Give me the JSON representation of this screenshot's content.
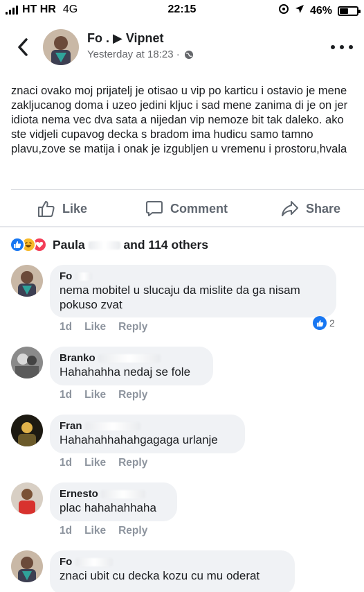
{
  "status_bar": {
    "carrier": "HT HR",
    "network": "4G",
    "time": "22:15",
    "battery": "46%"
  },
  "post": {
    "author": "Fo . ▶ Vipnet",
    "timestamp": "Yesterday at 18:23 ·",
    "text": "znaci ovako moj prijatelj je otisao u vip po karticu i ostavio je mene zakljucanog doma i uzeo jedini kljuc i sad mene zanima di je on jer idiota nema vec dva sata a nijedan vip nemoze bit tak daleko. ako ste vidjeli cupavog decka s bradom ima hudicu samo tamno plavu,zove se matija i onak je izgubljen u vremenu i prostoru,hvala"
  },
  "actions": {
    "like": "Like",
    "comment": "Comment",
    "share": "Share"
  },
  "reactions": {
    "summary_name": "Paula",
    "summary_rest": "and 114 others",
    "icons": [
      "like-icon",
      "haha-icon",
      "love-icon"
    ]
  },
  "comments": [
    {
      "name": "Fo",
      "text": "nema mobitel u slucaju da mislite da ga nisam pokuso zvat",
      "time": "1d",
      "like": "Like",
      "reply": "Reply",
      "reaction_count": "2"
    },
    {
      "name": "Branko",
      "text": "Hahahahha nedaj se fole",
      "time": "1d",
      "like": "Like",
      "reply": "Reply"
    },
    {
      "name": "Fran",
      "text": "Hahahahhahahgagaga urlanje",
      "time": "1d",
      "like": "Like",
      "reply": "Reply"
    },
    {
      "name": "Ernesto",
      "text": "plac hahahahhaha",
      "time": "1d",
      "like": "Like",
      "reply": "Reply"
    },
    {
      "name": "Fo",
      "text": "znaci ubit cu decka kozu cu mu oderat"
    }
  ],
  "colors": {
    "facebook_blue": "#1877f2",
    "haha_yellow": "#f7b928",
    "love_red": "#f33e58",
    "bubble_bg": "#f0f2f5"
  }
}
